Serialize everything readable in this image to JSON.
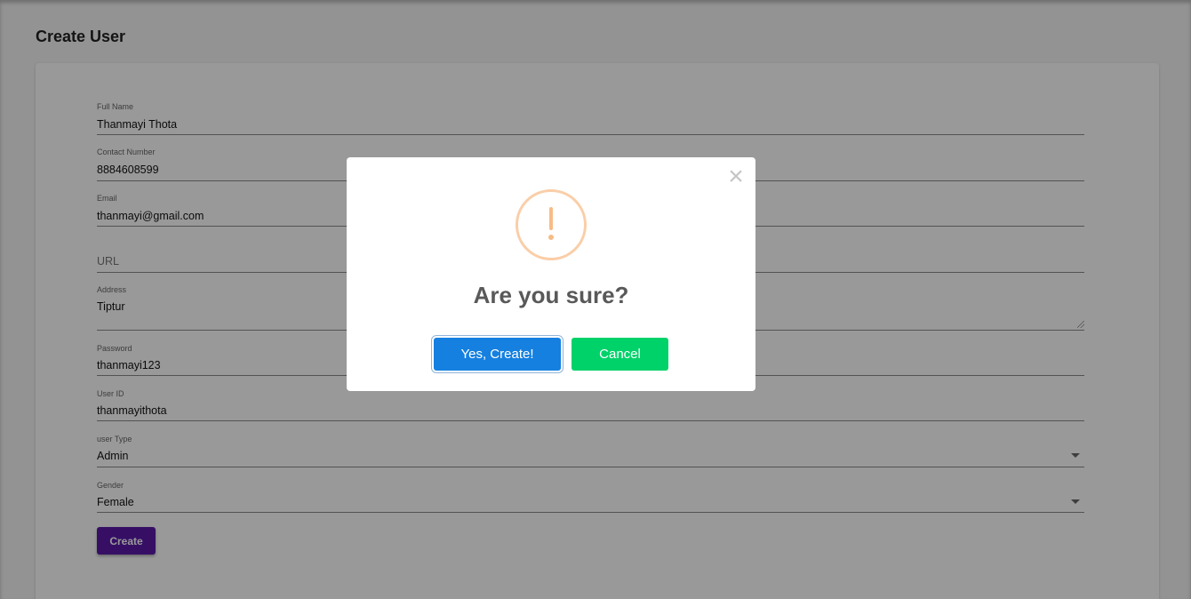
{
  "page": {
    "title": "Create User"
  },
  "form": {
    "full_name": {
      "label": "Full Name",
      "value": "Thanmayi Thota"
    },
    "contact_number": {
      "label": "Contact Number",
      "value": "8884608599"
    },
    "email": {
      "label": "Email",
      "value": "thanmayi@gmail.com"
    },
    "url": {
      "placeholder": "URL"
    },
    "address": {
      "label": "Address",
      "value": "Tiptur"
    },
    "password": {
      "label": "Password",
      "value": "thanmayi123"
    },
    "user_id": {
      "label": "User ID",
      "value": "thanmayithota"
    },
    "user_type": {
      "label": "user Type",
      "value": "Admin"
    },
    "gender": {
      "label": "Gender",
      "value": "Female"
    },
    "submit_label": "Create"
  },
  "dialog": {
    "title": "Are you sure?",
    "confirm_label": "Yes, Create!",
    "cancel_label": "Cancel",
    "close_glyph": "×",
    "icon": "warning-icon"
  },
  "colors": {
    "submit_button": "#5b1aa8",
    "confirm_button": "#1580e0",
    "cancel_button": "#00d26a",
    "warning_icon": "#f8bb86"
  }
}
